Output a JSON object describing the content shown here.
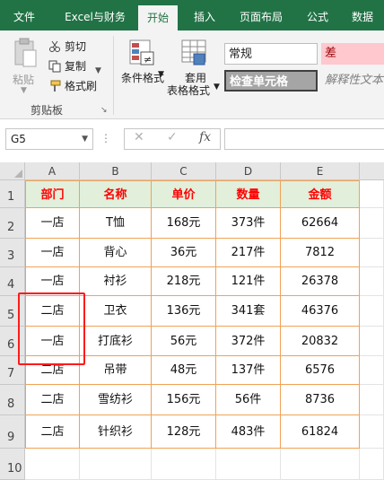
{
  "tabs": [
    "文件",
    "Excel与财务",
    "开始",
    "插入",
    "页面布局",
    "公式",
    "数据"
  ],
  "active_tab": "开始",
  "clipboard": {
    "paste_label": "粘贴",
    "cut_label": "剪切",
    "copy_label": "复制",
    "format_painter_label": "格式刷",
    "group_label": "剪贴板"
  },
  "styles": {
    "conditional_format_label": "条件格式",
    "table_format_label_1": "套用",
    "table_format_label_2": "表格格式",
    "normal": "常规",
    "bad": "差",
    "check_cell": "检查单元格",
    "explanatory": "解释性文本"
  },
  "formula_bar": {
    "name_box": "G5",
    "cancel_icon": "✕",
    "enter_icon": "✓",
    "fx_label": "fx",
    "formula": ""
  },
  "grid": {
    "columns": [
      "A",
      "B",
      "C",
      "D",
      "E"
    ],
    "rows": [
      "1",
      "2",
      "3",
      "4",
      "5",
      "6",
      "7",
      "8",
      "9",
      "10"
    ],
    "header": [
      "部门",
      "名称",
      "单价",
      "数量",
      "金额"
    ],
    "data": [
      [
        "一店",
        "T恤",
        "168元",
        "373件",
        "62664"
      ],
      [
        "一店",
        "背心",
        "36元",
        "217件",
        "7812"
      ],
      [
        "一店",
        "衬衫",
        "218元",
        "121件",
        "26378"
      ],
      [
        "二店",
        "卫衣",
        "136元",
        "341套",
        "46376"
      ],
      [
        "一店",
        "打底衫",
        "56元",
        "372件",
        "20832"
      ],
      [
        "二店",
        "吊带",
        "48元",
        "137件",
        "6576"
      ],
      [
        "二店",
        "雪纺衫",
        "156元",
        "56件",
        "8736"
      ],
      [
        "二店",
        "针织衫",
        "128元",
        "483件",
        "61824"
      ]
    ]
  },
  "colors": {
    "ribbon_green": "#217346",
    "table_border": "#f0a256",
    "header_fill": "#e2efda",
    "header_text": "#ff0000",
    "highlight": "#ff1a1a"
  }
}
